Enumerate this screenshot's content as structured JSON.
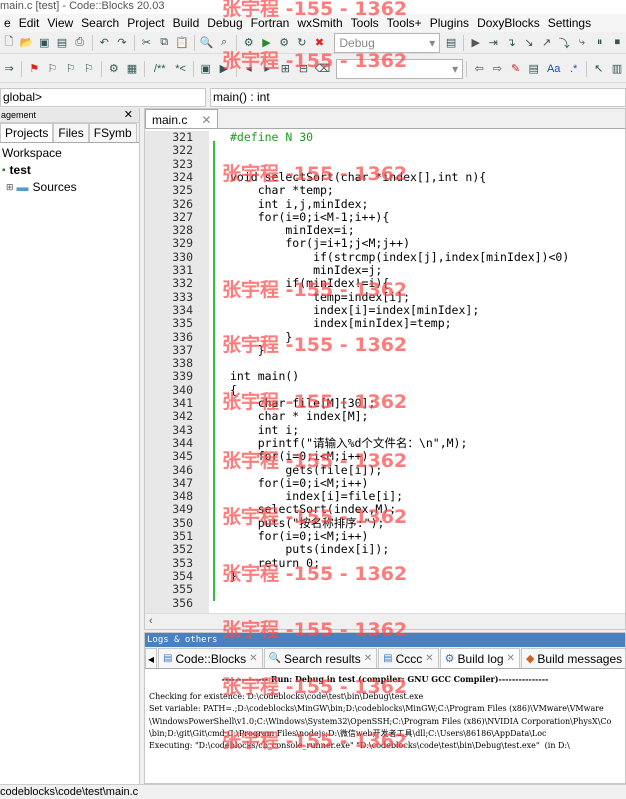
{
  "window": {
    "title": "main.c [test] - Code::Blocks 20.03"
  },
  "menu": [
    "e",
    "Edit",
    "View",
    "Search",
    "Project",
    "Build",
    "Debug",
    "Fortran",
    "wxSmith",
    "Tools",
    "Tools+",
    "Plugins",
    "DoxyBlocks",
    "Settings"
  ],
  "toolbar": {
    "build_target": "Debug",
    "search_value": ""
  },
  "scope": {
    "left": "global>",
    "right": "main() : int"
  },
  "left_panel": {
    "header": "agement",
    "tabs": [
      "Projects",
      "Files",
      "FSymb"
    ],
    "tree": {
      "workspace": "Workspace",
      "project": "test",
      "folder": "Sources"
    }
  },
  "editor": {
    "tab_label": "main.c",
    "lines": [
      {
        "num": "321",
        "text": "#define N 30",
        "cls": "pp"
      },
      {
        "num": "322",
        "text": ""
      },
      {
        "num": "323",
        "text": ""
      },
      {
        "num": "324",
        "text": "void selectSort(char *index[],int n){"
      },
      {
        "num": "325",
        "text": "    char *temp;"
      },
      {
        "num": "326",
        "text": "    int i,j,minIdex;"
      },
      {
        "num": "327",
        "text": "    for(i=0;i<M-1;i++){"
      },
      {
        "num": "328",
        "text": "        minIdex=i;"
      },
      {
        "num": "329",
        "text": "        for(j=i+1;j<M;j++)"
      },
      {
        "num": "330",
        "text": "            if(strcmp(index[j],index[minIdex])<0)"
      },
      {
        "num": "331",
        "text": "            minIdex=j;"
      },
      {
        "num": "332",
        "text": "        if(minIdex!=i){"
      },
      {
        "num": "333",
        "text": "            temp=index[i];"
      },
      {
        "num": "334",
        "text": "            index[i]=index[minIdex];"
      },
      {
        "num": "335",
        "text": "            index[minIdex]=temp;"
      },
      {
        "num": "336",
        "text": "        }"
      },
      {
        "num": "337",
        "text": "    }"
      },
      {
        "num": "338",
        "text": ""
      },
      {
        "num": "339",
        "text": "int main()"
      },
      {
        "num": "340",
        "text": "{"
      },
      {
        "num": "341",
        "text": "    char file[M][30];"
      },
      {
        "num": "342",
        "text": "    char * index[M];"
      },
      {
        "num": "343",
        "text": "    int i;"
      },
      {
        "num": "344",
        "text": "    printf(\"请输入%d个文件名：\\n\",M);"
      },
      {
        "num": "345",
        "text": "    for(i=0;i<M;i++)"
      },
      {
        "num": "346",
        "text": "        gets(file[i]);"
      },
      {
        "num": "347",
        "text": "    for(i=0;i<M;i++)"
      },
      {
        "num": "348",
        "text": "        index[i]=file[i];"
      },
      {
        "num": "349",
        "text": "    selectSort(index,M);"
      },
      {
        "num": "350",
        "text": "    puts(\"按名称排序:\");"
      },
      {
        "num": "351",
        "text": "    for(i=0;i<M;i++)"
      },
      {
        "num": "352",
        "text": "        puts(index[i]);"
      },
      {
        "num": "353",
        "text": "    return 0;"
      },
      {
        "num": "354",
        "text": "}"
      },
      {
        "num": "355",
        "text": ""
      },
      {
        "num": "356",
        "text": ""
      }
    ]
  },
  "logs": {
    "header": "Logs & others",
    "tabs": [
      "Code::Blocks",
      "Search results",
      "Cccc",
      "Build log",
      "Build messages"
    ],
    "active_tab": "Build log",
    "lines": [
      "-------------- Run: Debug in test (compiler: GNU GCC Compiler)---------------",
      "Checking for existence: D:\\codeblocks\\code\\test\\bin\\Debug\\test.exe",
      "Set variable: PATH=.;D:\\codeblocks\\MinGW\\bin;D:\\codeblocks\\MinGW;C:\\Program Files (x86)\\VMware\\VMware",
      "\\WindowsPowerShell\\v1.0;C:\\Windows\\System32\\OpenSSH;C:\\Program Files (x86)\\NVIDIA Corporation\\PhysX\\Co",
      "\\bin;D:\\git\\Git\\cmd;C:\\Program Files\\nodejs;D:\\微信web开发者工具\\dll;C:\\Users\\86186\\AppData\\Loc",
      "Executing: \"D:\\codeblocks/cb_console_runner.exe\" \"D:\\codeblocks\\code\\test\\bin\\Debug\\test.exe\"  (in D:\\"
    ]
  },
  "status": {
    "path": "codeblocks\\code\\test\\main.c"
  },
  "watermark": {
    "text": "张宇程 -155 - 1362"
  }
}
